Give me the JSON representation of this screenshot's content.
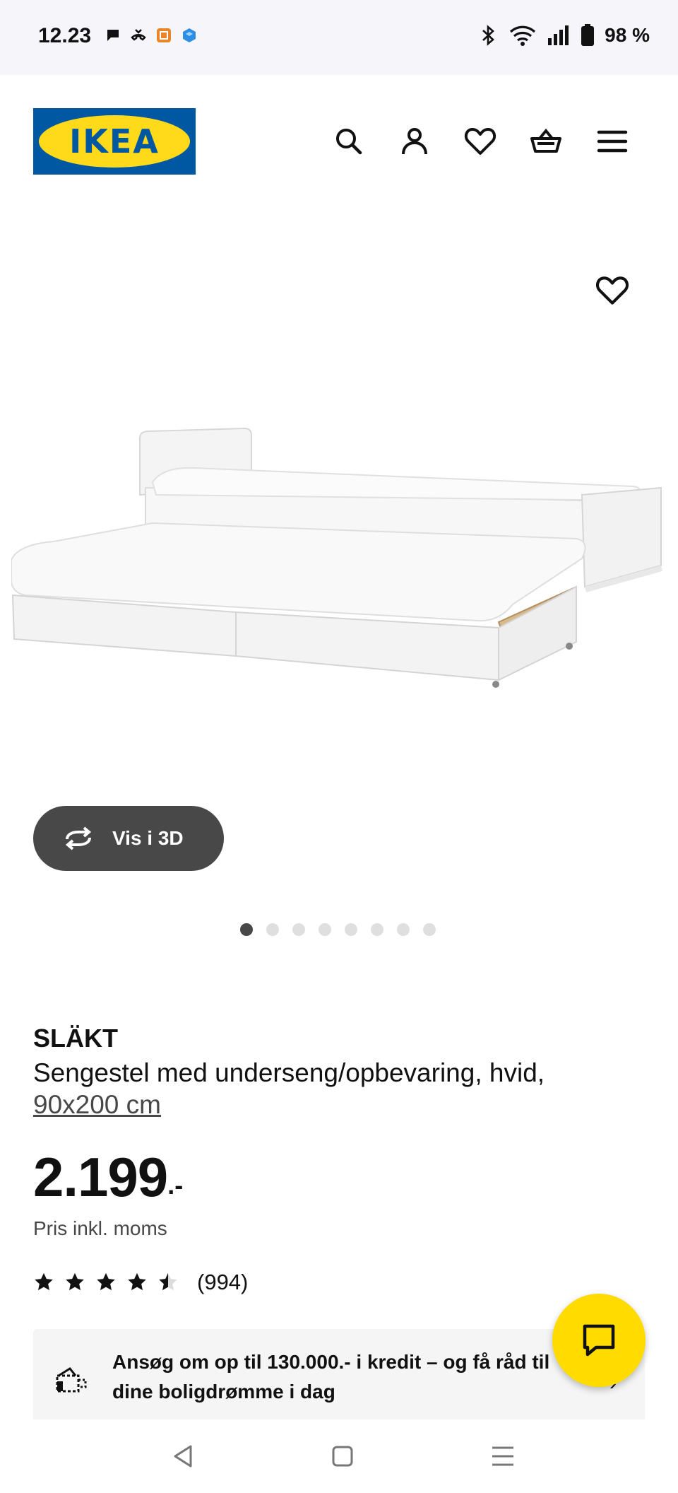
{
  "status_bar": {
    "time": "12.23",
    "battery": "98 %"
  },
  "header": {
    "logo_text": "IKEA",
    "icons": [
      "search-icon",
      "profile-icon",
      "heart-icon",
      "basket-icon",
      "menu-icon"
    ]
  },
  "gallery": {
    "view_3d_label": "Vis i 3D",
    "slide_count": 8,
    "active_slide": 1
  },
  "product": {
    "name": "SLÄKT",
    "description": "Sengestel med underseng/opbevaring, hvid,",
    "size": "90x200 cm",
    "price_whole": "2.199",
    "price_suffix": ".-",
    "price_note": "Pris inkl. moms",
    "rating": 4.5,
    "rating_max": 5,
    "review_count": "(994)"
  },
  "credit_banner": {
    "text": "Ansøg om op til 130.000.- i kredit – og få råd til dine boligdrømme i dag"
  },
  "colors": {
    "ikea_blue": "#0058a3",
    "ikea_yellow": "#ffda1a",
    "chat_yellow": "#ffdb00",
    "dark_gray": "#484848"
  }
}
